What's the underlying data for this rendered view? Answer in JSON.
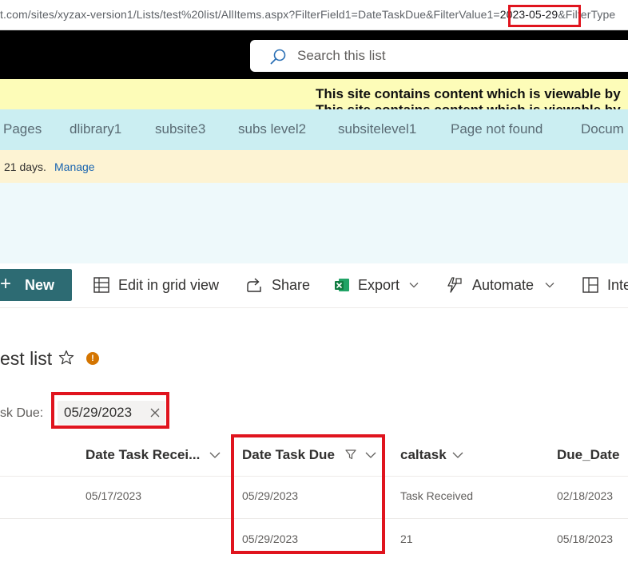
{
  "browser": {
    "url_prefix": "t.com/sites/xyzax-version1/Lists/test%20list/AllItems.aspx?FilterField1=DateTaskDue&FilterValue1=",
    "url_highlight": "2023-05-29",
    "url_suffix": "&FilterType"
  },
  "suite": {
    "search_placeholder": "Search this list"
  },
  "banner": {
    "message": "This site contains content which is viewable by"
  },
  "hub_nav": {
    "items": [
      "Pages",
      "dlibrary1",
      "subsite3",
      "subs level2",
      "subsitelevel1",
      "Page not found",
      "Docum"
    ]
  },
  "notice": {
    "text": "21 days.",
    "link": "Manage"
  },
  "command_bar": {
    "new_label": "New",
    "grid_label": "Edit in grid view",
    "share_label": "Share",
    "export_label": "Export",
    "automate_label": "Automate",
    "integrate_label": "Inte"
  },
  "list": {
    "title": "est list",
    "info_glyph": "!"
  },
  "filter": {
    "label": "sk Due:",
    "value": "05/29/2023"
  },
  "table": {
    "columns": [
      "Date Task Recei...",
      "Date Task Due",
      "caltask",
      "Due_Date"
    ],
    "rows": [
      [
        "05/17/2023",
        "05/29/2023",
        "Task Received",
        "02/18/2023"
      ],
      [
        "",
        "05/29/2023",
        "21",
        "05/18/2023"
      ]
    ]
  },
  "colors": {
    "highlight": "#e0141e",
    "new_button": "#2d6b73",
    "hub_nav_bg": "#cbeef2",
    "banner_bg": "#fdfcb8"
  }
}
